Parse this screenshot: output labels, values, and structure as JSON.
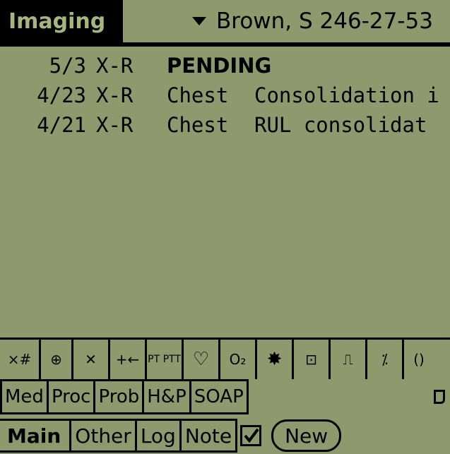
{
  "header": {
    "title": "Imaging",
    "patient": "Brown, S 246-27-53"
  },
  "studies": [
    {
      "date": "5/3",
      "modality": "X-R",
      "status": "PENDING",
      "body": "",
      "finding": ""
    },
    {
      "date": "4/23",
      "modality": "X-R",
      "status": "",
      "body": "Chest",
      "finding": "Consolidation i"
    },
    {
      "date": "4/21",
      "modality": "X-R",
      "status": "",
      "body": "Chest",
      "finding": "RUL consolidat"
    }
  ],
  "iconbar": [
    {
      "name": "calc-icon",
      "label": "×#"
    },
    {
      "name": "iv-bag-icon",
      "label": "⊕"
    },
    {
      "name": "cross-icon",
      "label": "✕"
    },
    {
      "name": "needle-icon",
      "label": "+←"
    },
    {
      "name": "pt-ptt-icon",
      "label": "PT PTT"
    },
    {
      "name": "heart-icon",
      "label": "♡"
    },
    {
      "name": "oxygen-icon",
      "label": "O₂"
    },
    {
      "name": "splat-icon",
      "label": "✸"
    },
    {
      "name": "lab-icon",
      "label": "⊡"
    },
    {
      "name": "ecg-icon",
      "label": "⎍"
    },
    {
      "name": "lytes-icon",
      "label": "⁒"
    },
    {
      "name": "lungs-icon",
      "label": "()"
    }
  ],
  "categories": [
    "Med",
    "Proc",
    "Prob",
    "H&P",
    "SOAP"
  ],
  "tabs": [
    "Main",
    "Other",
    "Log",
    "Note"
  ],
  "new_button": "New"
}
